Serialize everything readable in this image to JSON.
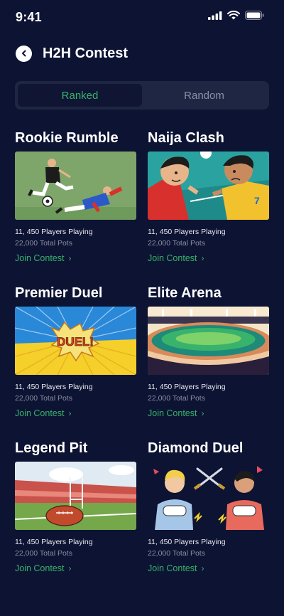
{
  "status": {
    "time": "9:41"
  },
  "header": {
    "title": "H2H Contest"
  },
  "toggle": {
    "ranked": "Ranked",
    "random": "Random"
  },
  "cards": [
    {
      "title": "Rookie Rumble",
      "players": "11, 450 Players Playing",
      "pots": "22,000 Total Pots",
      "join": "Join Contest"
    },
    {
      "title": "Naija Clash",
      "players": "11, 450 Players Playing",
      "pots": "22,000 Total Pots",
      "join": "Join Contest"
    },
    {
      "title": "Premier Duel",
      "players": "11, 450 Players Playing",
      "pots": "22,000 Total Pots",
      "join": "Join Contest",
      "image_text": "DUEL!"
    },
    {
      "title": "Elite Arena",
      "players": "11, 450 Players Playing",
      "pots": "22,000 Total Pots",
      "join": "Join Contest"
    },
    {
      "title": "Legend Pit",
      "players": "11, 450 Players Playing",
      "pots": "22,000 Total Pots",
      "join": "Join Contest"
    },
    {
      "title": "Diamond Duel",
      "players": "11, 450 Players Playing",
      "pots": "22,000 Total Pots",
      "join": "Join Contest"
    }
  ],
  "colors": {
    "background": "#0d1333",
    "accent": "#37b36a",
    "toggle_bg": "#1e2643"
  }
}
